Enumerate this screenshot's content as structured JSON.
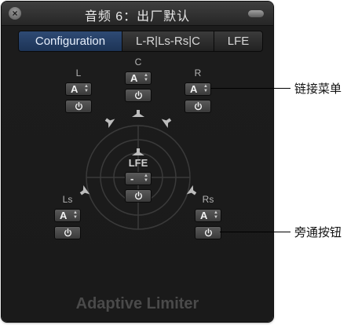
{
  "window": {
    "title": "音频 6：出厂默认",
    "close_glyph": "×"
  },
  "tabs": [
    {
      "label": "Configuration",
      "active": true
    },
    {
      "label": "L-R|Ls-Rs|C",
      "active": false
    },
    {
      "label": "LFE",
      "active": false
    }
  ],
  "channels": {
    "L": {
      "label": "L",
      "link_value": "A"
    },
    "C": {
      "label": "C",
      "link_value": "A"
    },
    "R": {
      "label": "R",
      "link_value": "A"
    },
    "LFE": {
      "label": "LFE",
      "link_value": "-"
    },
    "Ls": {
      "label": "Ls",
      "link_value": "A"
    },
    "Rs": {
      "label": "Rs",
      "link_value": "A"
    }
  },
  "plugin_name": "Adaptive Limiter",
  "callouts": {
    "link_menu": "链接菜单",
    "bypass_button": "旁通按钮"
  },
  "colors": {
    "panel_bg": "#1a1a1a",
    "active_tab": "#2e4a74",
    "control_bg": "#4a4a4a"
  },
  "icons": {
    "close": "close-icon",
    "minimize": "minimize-icon",
    "bypass": "power-icon",
    "speaker": "speaker-icon",
    "stepper": "up-down-arrows-icon"
  }
}
